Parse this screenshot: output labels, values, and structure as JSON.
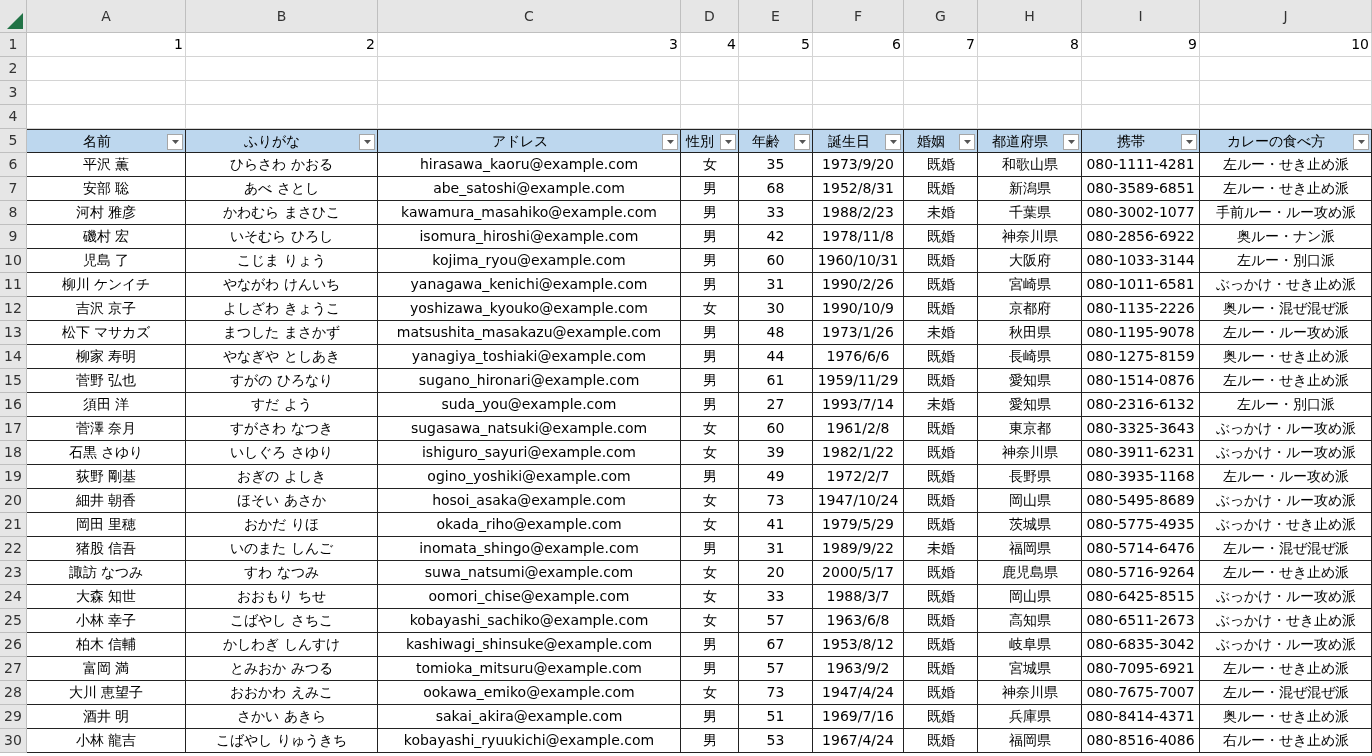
{
  "column_letters": [
    "A",
    "B",
    "C",
    "D",
    "E",
    "F",
    "G",
    "H",
    "I",
    "J"
  ],
  "row_numbers": [
    "1",
    "2",
    "3",
    "4",
    "5",
    "6",
    "7",
    "8",
    "9",
    "10",
    "11",
    "12",
    "13",
    "14",
    "15",
    "16",
    "17",
    "18",
    "19",
    "20",
    "21",
    "22",
    "23",
    "24",
    "25",
    "26",
    "27",
    "28",
    "29",
    "30"
  ],
  "row_1_values": [
    "1",
    "2",
    "3",
    "4",
    "5",
    "6",
    "7",
    "8",
    "9",
    "10"
  ],
  "table": {
    "columns": [
      "名前",
      "ふりがな",
      "アドレス",
      "性別",
      "年齢",
      "誕生日",
      "婚姻",
      "都道府県",
      "携帯",
      "カレーの食べ方"
    ],
    "rows": [
      [
        "平沢 薫",
        "ひらさわ かおる",
        "hirasawa_kaoru@example.com",
        "女",
        "35",
        "1973/9/20",
        "既婚",
        "和歌山県",
        "080-1111-4281",
        "左ルー・せき止め派"
      ],
      [
        "安部 聡",
        "あべ さとし",
        "abe_satoshi@example.com",
        "男",
        "68",
        "1952/8/31",
        "既婚",
        "新潟県",
        "080-3589-6851",
        "左ルー・せき止め派"
      ],
      [
        "河村 雅彦",
        "かわむら まさひこ",
        "kawamura_masahiko@example.com",
        "男",
        "33",
        "1988/2/23",
        "未婚",
        "千葉県",
        "080-3002-1077",
        "手前ルー・ルー攻め派"
      ],
      [
        "磯村 宏",
        "いそむら ひろし",
        "isomura_hiroshi@example.com",
        "男",
        "42",
        "1978/11/8",
        "既婚",
        "神奈川県",
        "080-2856-6922",
        "奥ルー・ナン派"
      ],
      [
        "児島 了",
        "こじま りょう",
        "kojima_ryou@example.com",
        "男",
        "60",
        "1960/10/31",
        "既婚",
        "大阪府",
        "080-1033-3144",
        "左ルー・別口派"
      ],
      [
        "柳川 ケンイチ",
        "やながわ けんいち",
        "yanagawa_kenichi@example.com",
        "男",
        "31",
        "1990/2/26",
        "既婚",
        "宮崎県",
        "080-1011-6581",
        "ぶっかけ・せき止め派"
      ],
      [
        "吉沢 京子",
        "よしざわ きょうこ",
        "yoshizawa_kyouko@example.com",
        "女",
        "30",
        "1990/10/9",
        "既婚",
        "京都府",
        "080-1135-2226",
        "奥ルー・混ぜ混ぜ派"
      ],
      [
        "松下 マサカズ",
        "まつした まさかず",
        "matsushita_masakazu@example.com",
        "男",
        "48",
        "1973/1/26",
        "未婚",
        "秋田県",
        "080-1195-9078",
        "左ルー・ルー攻め派"
      ],
      [
        "柳家 寿明",
        "やなぎや としあき",
        "yanagiya_toshiaki@example.com",
        "男",
        "44",
        "1976/6/6",
        "既婚",
        "長崎県",
        "080-1275-8159",
        "奥ルー・せき止め派"
      ],
      [
        "菅野 弘也",
        "すがの ひろなり",
        "sugano_hironari@example.com",
        "男",
        "61",
        "1959/11/29",
        "既婚",
        "愛知県",
        "080-1514-0876",
        "左ルー・せき止め派"
      ],
      [
        "須田 洋",
        "すだ よう",
        "suda_you@example.com",
        "男",
        "27",
        "1993/7/14",
        "未婚",
        "愛知県",
        "080-2316-6132",
        "左ルー・別口派"
      ],
      [
        "菅澤 奈月",
        "すがさわ なつき",
        "sugasawa_natsuki@example.com",
        "女",
        "60",
        "1961/2/8",
        "既婚",
        "東京都",
        "080-3325-3643",
        "ぶっかけ・ルー攻め派"
      ],
      [
        "石黒 さゆり",
        "いしぐろ さゆり",
        "ishiguro_sayuri@example.com",
        "女",
        "39",
        "1982/1/22",
        "既婚",
        "神奈川県",
        "080-3911-6231",
        "ぶっかけ・ルー攻め派"
      ],
      [
        "荻野 剛基",
        "おぎの よしき",
        "ogino_yoshiki@example.com",
        "男",
        "49",
        "1972/2/7",
        "既婚",
        "長野県",
        "080-3935-1168",
        "左ルー・ルー攻め派"
      ],
      [
        "細井 朝香",
        "ほそい あさか",
        "hosoi_asaka@example.com",
        "女",
        "73",
        "1947/10/24",
        "既婚",
        "岡山県",
        "080-5495-8689",
        "ぶっかけ・ルー攻め派"
      ],
      [
        "岡田 里穂",
        "おかだ りほ",
        "okada_riho@example.com",
        "女",
        "41",
        "1979/5/29",
        "既婚",
        "茨城県",
        "080-5775-4935",
        "ぶっかけ・せき止め派"
      ],
      [
        "猪股 信吾",
        "いのまた しんご",
        "inomata_shingo@example.com",
        "男",
        "31",
        "1989/9/22",
        "未婚",
        "福岡県",
        "080-5714-6476",
        "左ルー・混ぜ混ぜ派"
      ],
      [
        "諏訪 なつみ",
        "すわ なつみ",
        "suwa_natsumi@example.com",
        "女",
        "20",
        "2000/5/17",
        "既婚",
        "鹿児島県",
        "080-5716-9264",
        "左ルー・せき止め派"
      ],
      [
        "大森 知世",
        "おおもり ちせ",
        "oomori_chise@example.com",
        "女",
        "33",
        "1988/3/7",
        "既婚",
        "岡山県",
        "080-6425-8515",
        "ぶっかけ・ルー攻め派"
      ],
      [
        "小林 幸子",
        "こばやし さちこ",
        "kobayashi_sachiko@example.com",
        "女",
        "57",
        "1963/6/8",
        "既婚",
        "高知県",
        "080-6511-2673",
        "ぶっかけ・せき止め派"
      ],
      [
        "柏木 信輔",
        "かしわぎ しんすけ",
        "kashiwagi_shinsuke@example.com",
        "男",
        "67",
        "1953/8/12",
        "既婚",
        "岐阜県",
        "080-6835-3042",
        "ぶっかけ・ルー攻め派"
      ],
      [
        "富岡 満",
        "とみおか みつる",
        "tomioka_mitsuru@example.com",
        "男",
        "57",
        "1963/9/2",
        "既婚",
        "宮城県",
        "080-7095-6921",
        "左ルー・せき止め派"
      ],
      [
        "大川 恵望子",
        "おおかわ えみこ",
        "ookawa_emiko@example.com",
        "女",
        "73",
        "1947/4/24",
        "既婚",
        "神奈川県",
        "080-7675-7007",
        "左ルー・混ぜ混ぜ派"
      ],
      [
        "酒井 明",
        "さかい あきら",
        "sakai_akira@example.com",
        "男",
        "51",
        "1969/7/16",
        "既婚",
        "兵庫県",
        "080-8414-4371",
        "奥ルー・せき止め派"
      ],
      [
        "小林 龍吉",
        "こばやし りゅうきち",
        "kobayashi_ryuukichi@example.com",
        "男",
        "53",
        "1967/4/24",
        "既婚",
        "福岡県",
        "080-8516-4086",
        "右ルー・せき止め派"
      ]
    ]
  }
}
